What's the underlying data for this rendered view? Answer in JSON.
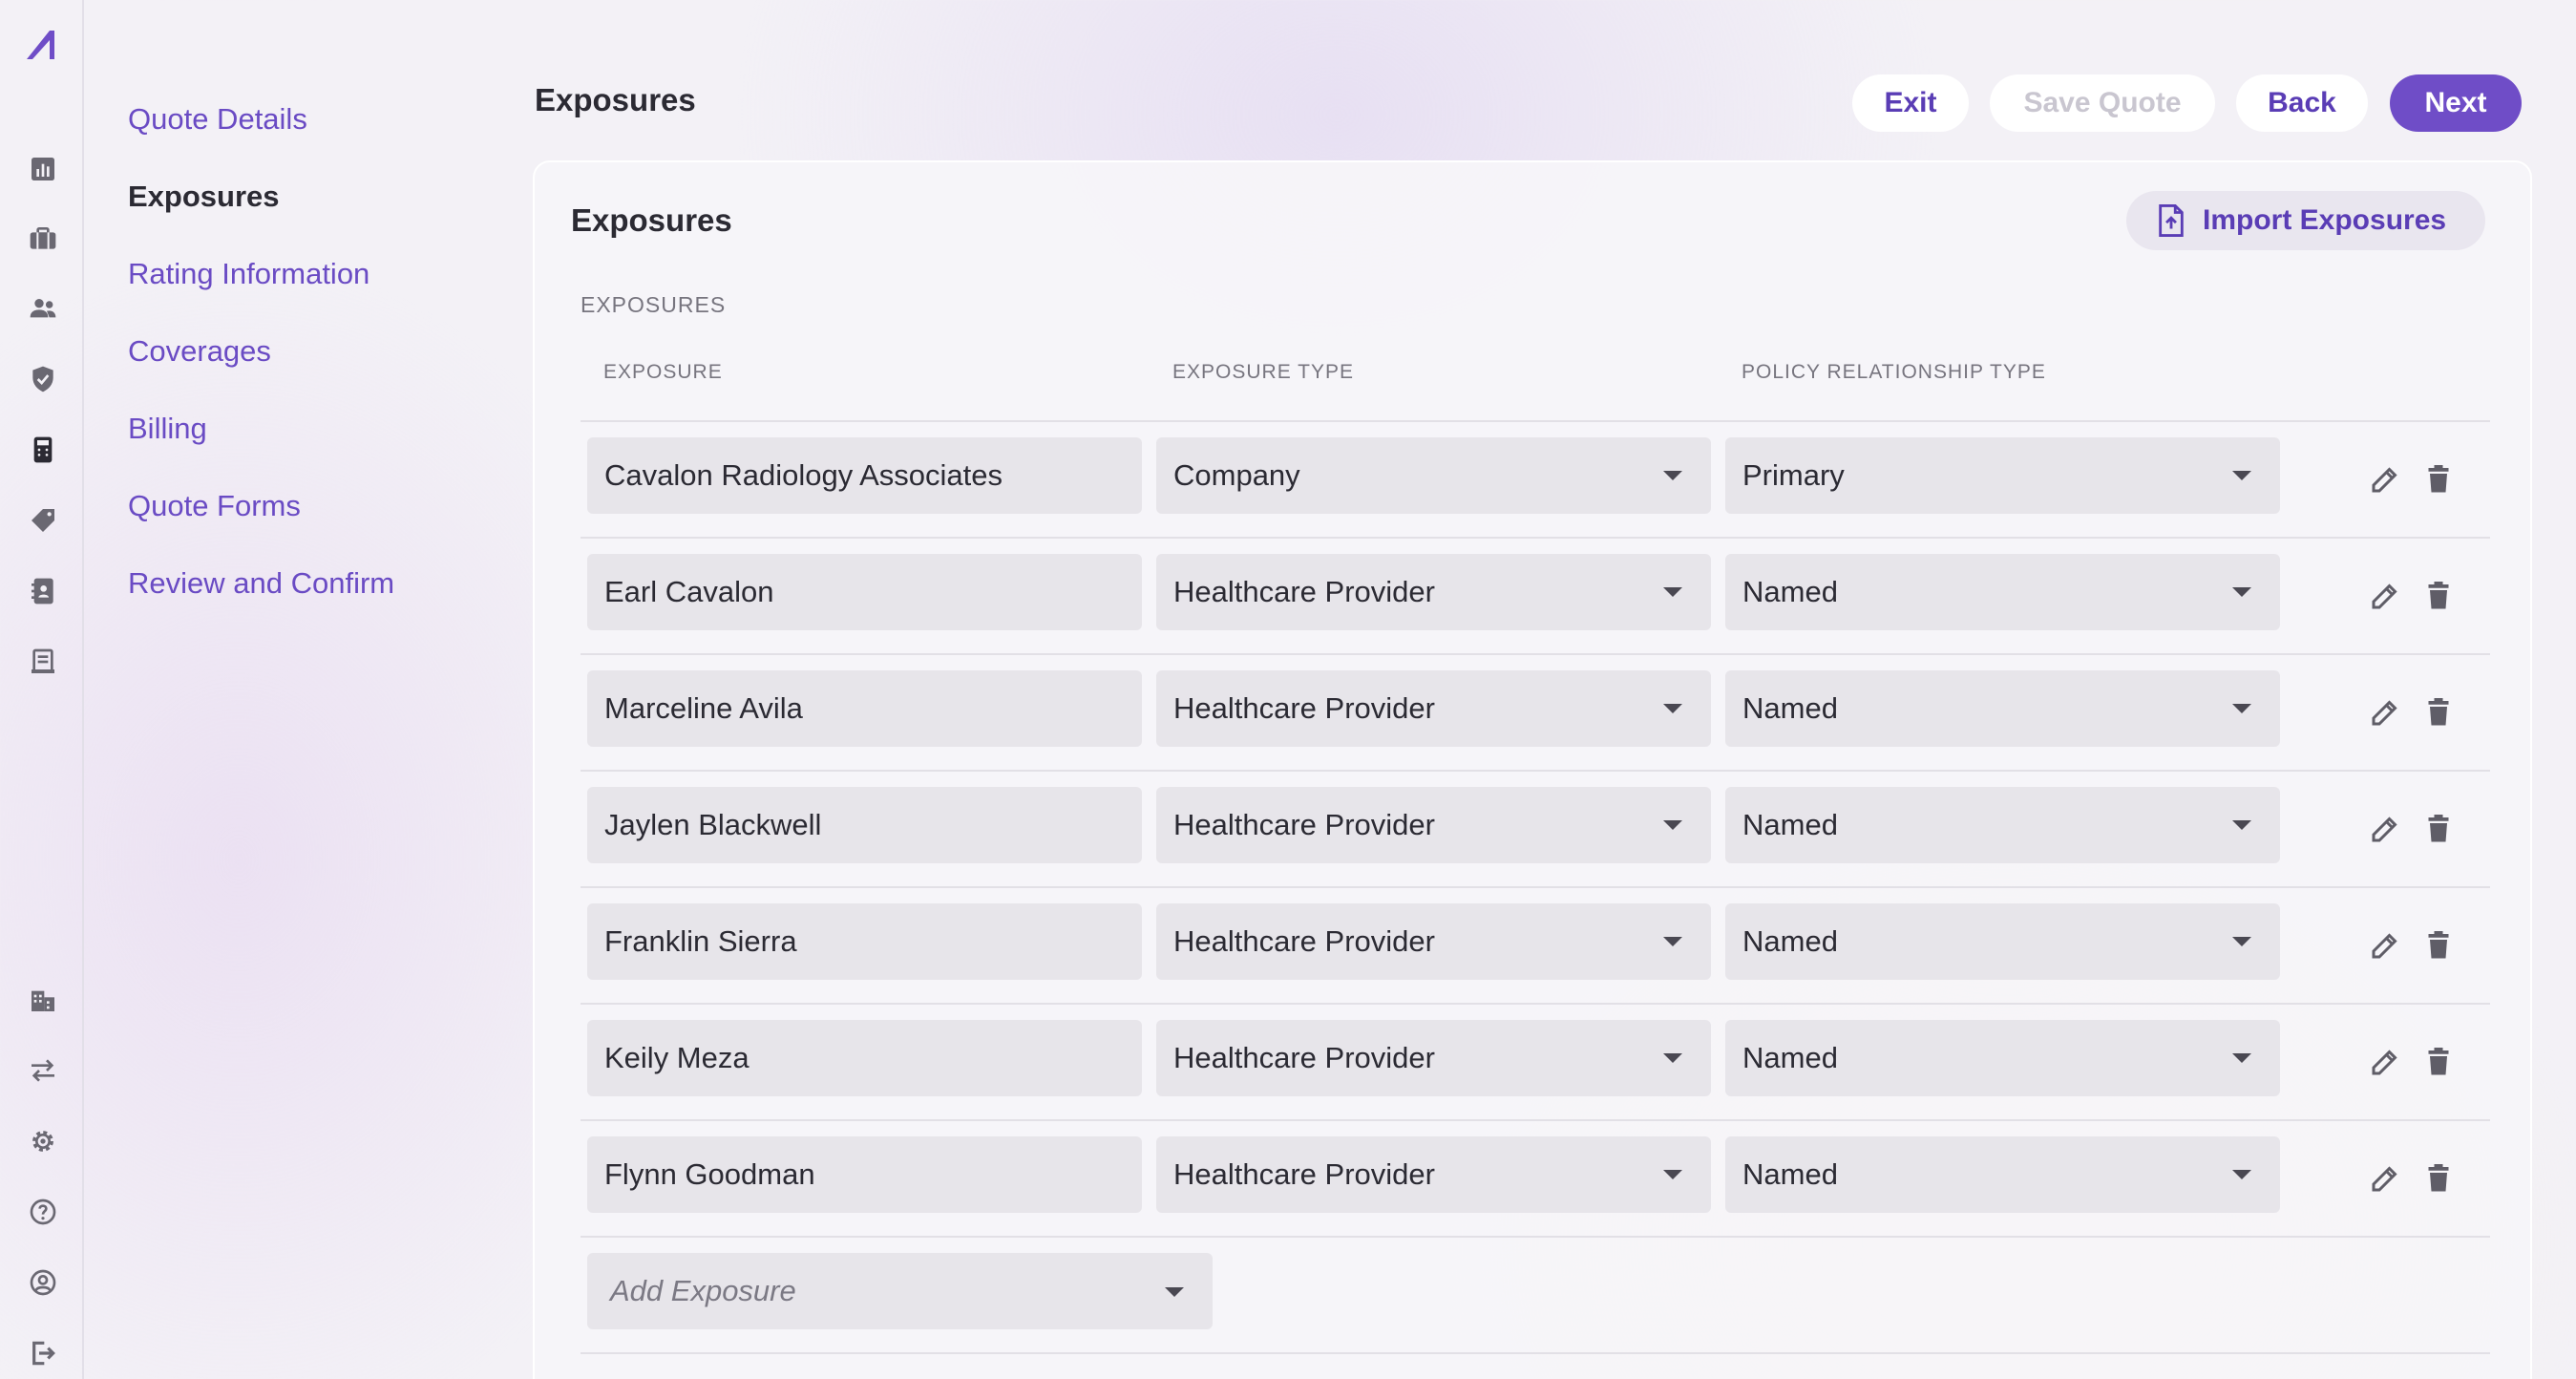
{
  "steps": [
    {
      "label": "Quote Details",
      "active": false
    },
    {
      "label": "Exposures",
      "active": true
    },
    {
      "label": "Rating Information",
      "active": false
    },
    {
      "label": "Coverages",
      "active": false
    },
    {
      "label": "Billing",
      "active": false
    },
    {
      "label": "Quote Forms",
      "active": false
    },
    {
      "label": "Review and Confirm",
      "active": false
    }
  ],
  "header": {
    "title": "Exposures",
    "exit_label": "Exit",
    "save_label": "Save Quote",
    "back_label": "Back",
    "next_label": "Next"
  },
  "card": {
    "title": "Exposures",
    "import_label": "Import Exposures",
    "section_label": "EXPOSURES",
    "columns": [
      "EXPOSURE",
      "EXPOSURE TYPE",
      "POLICY RELATIONSHIP TYPE"
    ],
    "rows": [
      {
        "exposure": "Cavalon Radiology Associates",
        "type": "Company",
        "relationship": "Primary"
      },
      {
        "exposure": "Earl Cavalon",
        "type": "Healthcare Provider",
        "relationship": "Named"
      },
      {
        "exposure": "Marceline Avila",
        "type": "Healthcare Provider",
        "relationship": "Named"
      },
      {
        "exposure": "Jaylen Blackwell",
        "type": "Healthcare Provider",
        "relationship": "Named"
      },
      {
        "exposure": "Franklin Sierra",
        "type": "Healthcare Provider",
        "relationship": "Named"
      },
      {
        "exposure": "Keily Meza",
        "type": "Healthcare Provider",
        "relationship": "Named"
      },
      {
        "exposure": "Flynn Goodman",
        "type": "Healthcare Provider",
        "relationship": "Named"
      }
    ],
    "add_placeholder": "Add Exposure"
  },
  "colors": {
    "accent": "#6f4dc7",
    "link": "#6a4bc4",
    "icon": "#6a6872"
  },
  "rail_icons": [
    "chart-icon",
    "briefcase-icon",
    "people-icon",
    "shield-icon",
    "calculator-icon",
    "tag-icon",
    "contacts-icon",
    "receipt-icon",
    "building-icon",
    "swap-icon",
    "gear-icon",
    "help-icon",
    "user-icon",
    "logout-icon"
  ]
}
